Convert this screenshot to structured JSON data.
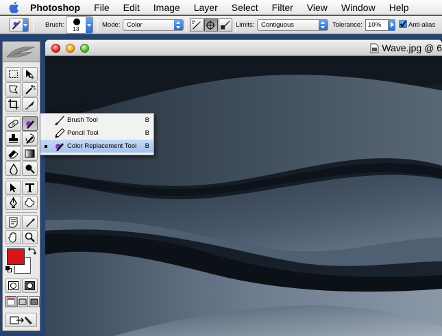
{
  "menubar": {
    "app_name": "Photoshop",
    "items": [
      "File",
      "Edit",
      "Image",
      "Layer",
      "Select",
      "Filter",
      "View",
      "Window",
      "Help"
    ]
  },
  "options_bar": {
    "brush_label": "Brush:",
    "brush_size": "13",
    "mode_label": "Mode:",
    "mode_value": "Color",
    "limits_label": "Limits:",
    "limits_value": "Contiguous",
    "tolerance_label": "Tolerance:",
    "tolerance_value": "10%",
    "antialias_label": "Anti-alias",
    "antialias_checked": true
  },
  "toolbox": {
    "foreground_color": "#d8141a",
    "background_color": "#ffffff"
  },
  "document": {
    "title": "Wave.jpg @ 6"
  },
  "flyout": {
    "items": [
      {
        "label": "Brush Tool",
        "shortcut": "B",
        "icon": "brush-icon",
        "selected": false
      },
      {
        "label": "Pencil Tool",
        "shortcut": "B",
        "icon": "pencil-icon",
        "selected": false
      },
      {
        "label": "Color Replacement Tool",
        "shortcut": "B",
        "icon": "color-replacement-icon",
        "selected": true
      }
    ]
  }
}
